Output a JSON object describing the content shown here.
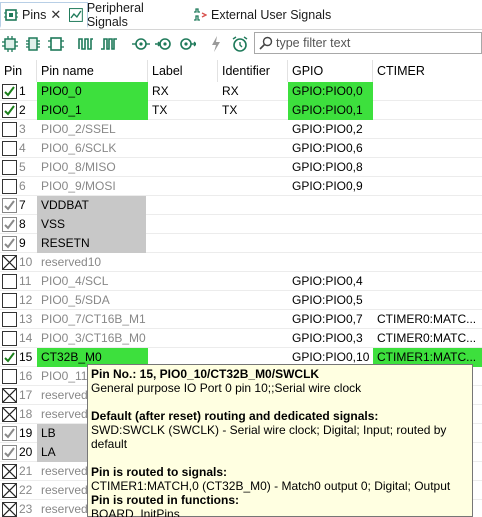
{
  "tabs": [
    {
      "label": "Pins",
      "active": true,
      "icon": "pins-icon"
    },
    {
      "label": "Peripheral Signals",
      "active": false,
      "icon": "chart-icon"
    },
    {
      "label": "External User Signals",
      "active": false,
      "icon": "signals-icon"
    }
  ],
  "filter": {
    "placeholder": "type filter text"
  },
  "columns": [
    "Pin",
    "Pin name",
    "Label",
    "Identifier",
    "GPIO",
    "CTIMER"
  ],
  "rows": [
    {
      "pin": "1",
      "state": "checked",
      "name": "PIO0_0",
      "name_style": "green",
      "label": "RX",
      "identifier": "RX",
      "gpio": "GPIO:PIO0,0",
      "gpio_style": "green",
      "ctimer": "",
      "ctimer_style": ""
    },
    {
      "pin": "2",
      "state": "checked",
      "name": "PIO0_1",
      "name_style": "green",
      "label": "TX",
      "identifier": "TX",
      "gpio": "GPIO:PIO0,1",
      "gpio_style": "green",
      "ctimer": "",
      "ctimer_style": ""
    },
    {
      "pin": "3",
      "state": "empty",
      "name": "PIO0_2/SSEL",
      "name_style": "grey",
      "label": "",
      "identifier": "",
      "gpio": "GPIO:PIO0,2",
      "gpio_style": "",
      "ctimer": "",
      "ctimer_style": ""
    },
    {
      "pin": "4",
      "state": "empty",
      "name": "PIO0_6/SCLK",
      "name_style": "grey",
      "label": "",
      "identifier": "",
      "gpio": "GPIO:PIO0,6",
      "gpio_style": "",
      "ctimer": "",
      "ctimer_style": ""
    },
    {
      "pin": "5",
      "state": "empty",
      "name": "PIO0_8/MISO",
      "name_style": "grey",
      "label": "",
      "identifier": "",
      "gpio": "GPIO:PIO0,8",
      "gpio_style": "",
      "ctimer": "",
      "ctimer_style": ""
    },
    {
      "pin": "6",
      "state": "empty",
      "name": "PIO0_9/MOSI",
      "name_style": "grey",
      "label": "",
      "identifier": "",
      "gpio": "GPIO:PIO0,9",
      "gpio_style": "",
      "ctimer": "",
      "ctimer_style": ""
    },
    {
      "pin": "7",
      "state": "greycheck",
      "name": "VDDBAT",
      "name_style": "greybg",
      "label": "",
      "identifier": "",
      "gpio": "",
      "gpio_style": "",
      "ctimer": "",
      "ctimer_style": ""
    },
    {
      "pin": "8",
      "state": "greycheck",
      "name": "VSS",
      "name_style": "greybg",
      "label": "",
      "identifier": "",
      "gpio": "",
      "gpio_style": "",
      "ctimer": "",
      "ctimer_style": ""
    },
    {
      "pin": "9",
      "state": "greycheck",
      "name": "RESETN",
      "name_style": "greybg",
      "label": "",
      "identifier": "",
      "gpio": "",
      "gpio_style": "",
      "ctimer": "",
      "ctimer_style": ""
    },
    {
      "pin": "10",
      "state": "cross",
      "name": "reserved10",
      "name_style": "grey",
      "label": "",
      "identifier": "",
      "gpio": "",
      "gpio_style": "",
      "ctimer": "",
      "ctimer_style": ""
    },
    {
      "pin": "11",
      "state": "empty",
      "name": "PIO0_4/SCL",
      "name_style": "grey",
      "label": "",
      "identifier": "",
      "gpio": "GPIO:PIO0,4",
      "gpio_style": "",
      "ctimer": "",
      "ctimer_style": ""
    },
    {
      "pin": "12",
      "state": "empty",
      "name": "PIO0_5/SDA",
      "name_style": "grey",
      "label": "",
      "identifier": "",
      "gpio": "GPIO:PIO0,5",
      "gpio_style": "",
      "ctimer": "",
      "ctimer_style": ""
    },
    {
      "pin": "13",
      "state": "empty",
      "name": "PIO0_7/CT16B_M1",
      "name_style": "grey",
      "label": "",
      "identifier": "",
      "gpio": "GPIO:PIO0,7",
      "gpio_style": "",
      "ctimer": "CTIMER0:MATC...",
      "ctimer_style": ""
    },
    {
      "pin": "14",
      "state": "empty",
      "name": "PIO0_3/CT16B_M0",
      "name_style": "grey",
      "label": "",
      "identifier": "",
      "gpio": "GPIO:PIO0,3",
      "gpio_style": "",
      "ctimer": "CTIMER0:MATC...",
      "ctimer_style": ""
    },
    {
      "pin": "15",
      "state": "checked",
      "name": "CT32B_M0",
      "name_style": "green",
      "label": "",
      "identifier": "",
      "gpio": "GPIO:PIO0,10",
      "gpio_style": "",
      "ctimer": "CTIMER1:MATC...",
      "ctimer_style": "green"
    },
    {
      "pin": "16",
      "state": "empty",
      "name": "PIO0_11/",
      "name_style": "grey",
      "label": "",
      "identifier": "",
      "gpio": "",
      "gpio_style": "",
      "ctimer": "",
      "ctimer_style": ""
    },
    {
      "pin": "17",
      "state": "cross",
      "name": "reserved",
      "name_style": "grey",
      "label": "",
      "identifier": "",
      "gpio": "",
      "gpio_style": "",
      "ctimer": "",
      "ctimer_style": ""
    },
    {
      "pin": "18",
      "state": "cross",
      "name": "reserved",
      "name_style": "grey",
      "label": "",
      "identifier": "",
      "gpio": "",
      "gpio_style": "",
      "ctimer": "",
      "ctimer_style": ""
    },
    {
      "pin": "19",
      "state": "greycheck",
      "name": "LB",
      "name_style": "greybg",
      "label": "",
      "identifier": "",
      "gpio": "",
      "gpio_style": "",
      "ctimer": "",
      "ctimer_style": ""
    },
    {
      "pin": "20",
      "state": "greycheck",
      "name": "LA",
      "name_style": "greybg",
      "label": "",
      "identifier": "",
      "gpio": "",
      "gpio_style": "",
      "ctimer": "",
      "ctimer_style": ""
    },
    {
      "pin": "21",
      "state": "cross",
      "name": "reserved",
      "name_style": "grey",
      "label": "",
      "identifier": "",
      "gpio": "",
      "gpio_style": "",
      "ctimer": "",
      "ctimer_style": ""
    },
    {
      "pin": "22",
      "state": "cross",
      "name": "reserved",
      "name_style": "grey",
      "label": "",
      "identifier": "",
      "gpio": "",
      "gpio_style": "",
      "ctimer": "",
      "ctimer_style": ""
    },
    {
      "pin": "23",
      "state": "cross",
      "name": "reserved",
      "name_style": "grey",
      "label": "",
      "identifier": "",
      "gpio": "",
      "gpio_style": "",
      "ctimer": "",
      "ctimer_style": ""
    }
  ],
  "tooltip": {
    "title": "Pin No.: 15, PIO0_10/CT32B_M0/SWCLK",
    "description": "General purpose IO Port 0 pin 10;;Serial wire clock",
    "default_heading": "Default (after reset) routing and dedicated signals:",
    "default_text": "SWD:SWCLK (SWCLK) - Serial wire clock; Digital; Input; routed by default",
    "routed_heading": "Pin is routed to signals:",
    "routed_text": "CTIMER1:MATCH,0 (CT32B_M0) - Match0 output 0; Digital; Output",
    "functions_heading": "Pin is routed in functions:",
    "functions_text": "BOARD_InitPins"
  },
  "colors": {
    "accent_green": "#3de03d",
    "grey_bg": "#c8c8c8",
    "tooltip_bg": "#ffffe1"
  }
}
